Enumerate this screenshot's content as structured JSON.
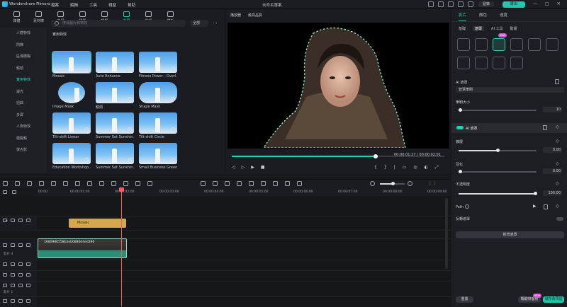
{
  "titlebar": {
    "app_title": "Wondershare Filmora",
    "menu": [
      "檔案",
      "編輯",
      "工具",
      "視窗",
      "幫助"
    ],
    "project_title": "未命名專案",
    "login_label": "登錄",
    "export_label": "導出"
  },
  "media": {
    "tools": [
      {
        "label": "媒體",
        "icon": "media-icon"
      },
      {
        "label": "素材庫",
        "icon": "library-icon"
      },
      {
        "label": "音頻",
        "icon": "music-icon"
      },
      {
        "label": "標題",
        "icon": "title-icon"
      },
      {
        "label": "轉場",
        "icon": "transition-icon"
      },
      {
        "label": "效果",
        "icon": "effects-icon"
      },
      {
        "label": "貼紙",
        "icon": "sticker-icon"
      },
      {
        "label": "模板",
        "icon": "template-icon"
      }
    ],
    "active_tool": 5,
    "sidebar": [
      "人體特效",
      "閃爍",
      "區塊模糊",
      "鏡頭",
      "實用特效",
      "濾光",
      "扭曲",
      "多屏",
      "人物特效",
      "模擬鏡",
      "復古影"
    ],
    "active_sidebar": 4,
    "search_placeholder": "搜尋圖片和特效",
    "filter_label": "全部",
    "section_title": "實用特效",
    "effects": [
      "Mosaic",
      "Auto Enhance",
      "Fitness Power - Overl...",
      "Image Mask",
      "鏡頭",
      "Shape Mask",
      "Tilt-shift Linear",
      "Summer Set Sunshin...",
      "Tilt-shift Circle",
      "Education Workshop...",
      "Summer Set Sunshin...",
      "Small Business Green..."
    ]
  },
  "preview": {
    "tabs": [
      "播放器",
      "最高品質"
    ],
    "time_current": "00:00:01:27",
    "time_total": "00:00:02:01",
    "progress": 0.68
  },
  "timeline": {
    "ruler": [
      "00:00",
      "00:00:01:00",
      "00:00:02:00",
      "00:00:03:00",
      "00:00:04:00",
      "00:00:05:00",
      "00:00:06:00",
      "00:00:07:00",
      "00:00:08:00",
      "00:00:09:00"
    ],
    "fx_clip": "Mosaic",
    "video_clip": "1680980558b5eb0880d4ed390",
    "track_numbers": [
      "6",
      "5",
      "4",
      "3",
      "2",
      "1"
    ],
    "track_sub": [
      "影片 4",
      "影片 1"
    ]
  },
  "props": {
    "tabs": [
      "影片",
      "顏色",
      "速度"
    ],
    "subtabs": [
      "基礎",
      "遮罩",
      "AI 工具",
      "動畫"
    ],
    "badge_new": "NEW",
    "ai_mask_label": "AI 遮罩",
    "ai_mask_dropdown": "智慧筆刷",
    "brush_size_label": "筆刷大小",
    "brush_size_value": "10",
    "ai_mask_section": "AI 遮罩",
    "feather_label": "擴展",
    "feather_value": "0.00",
    "blur_label": "羽化",
    "blur_value": "0.00",
    "opacity_label": "不透明度",
    "opacity_value": "100.00",
    "path_label": "Path",
    "invert_label": "反轉遮罩",
    "new_mask_label": "新增遮罩",
    "reset_label": "重置",
    "keyframe_label": "關鍵幀面板",
    "save_label": "儲存為預設"
  },
  "colors": {
    "accent": "#25d0b5",
    "playhead": "#ff5c5c",
    "fx_clip": "#d6a64a"
  }
}
